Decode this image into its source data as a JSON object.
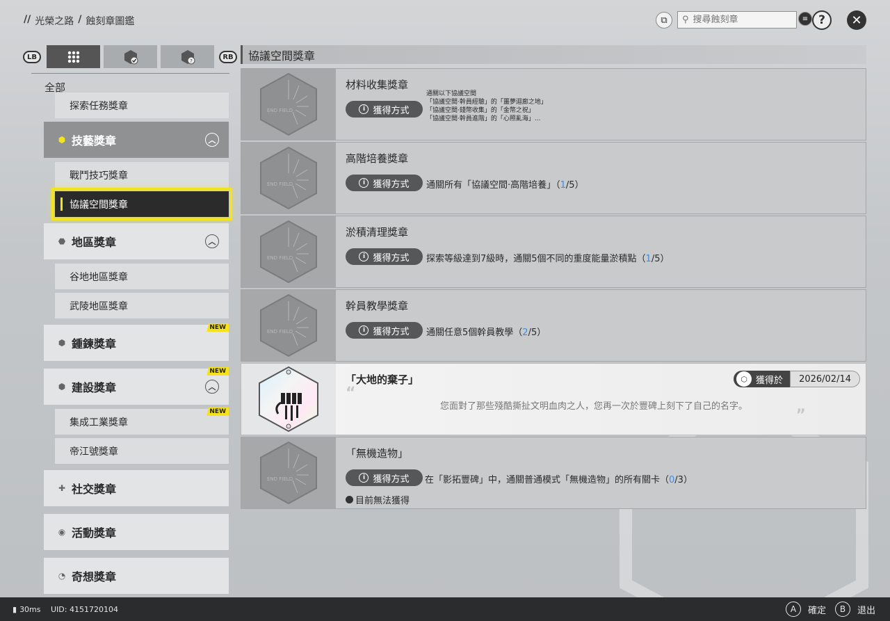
{
  "breadcrumb": [
    "光榮之路",
    "蝕刻章圖鑑"
  ],
  "search": {
    "placeholder": "搜尋蝕刻章"
  },
  "header_icons": {
    "filter": "filter-icon",
    "help": "?",
    "close": "✕",
    "list": "list-icon"
  },
  "tabs": {
    "lb": "LB",
    "rb": "RB"
  },
  "sidebar": {
    "all_label": "全部",
    "items": [
      {
        "type": "sub",
        "label": "探索任務獎章"
      },
      {
        "type": "cat",
        "label": "技藝獎章",
        "open": true
      },
      {
        "type": "sub",
        "label": "戰鬥技巧獎章"
      },
      {
        "type": "sub",
        "label": "協議空間獎章",
        "selected": true
      },
      {
        "type": "cat",
        "label": "地區獎章"
      },
      {
        "type": "sub",
        "label": "谷地地區獎章"
      },
      {
        "type": "sub",
        "label": "武陵地區獎章"
      },
      {
        "type": "cat",
        "label": "鍾鍊獎章",
        "badge": "NEW"
      },
      {
        "type": "cat",
        "label": "建設獎章",
        "badge": "NEW"
      },
      {
        "type": "sub",
        "label": "集成工業獎章",
        "badge": "NEW"
      },
      {
        "type": "sub",
        "label": "帝江號獎章"
      },
      {
        "type": "cat",
        "label": "社交獎章"
      },
      {
        "type": "cat",
        "label": "活動獎章"
      },
      {
        "type": "cat",
        "label": "奇想獎章"
      }
    ]
  },
  "section_title": "協議空間獎章",
  "method_label": "獲得方式",
  "cards": [
    {
      "name": "材料收集獎章",
      "cond_lines": [
        "通關以下協議空間",
        "「協議空間·幹員經驗」的「噩夢迴廊之地」",
        "「協議空間·錢幣收集」的「金幣之祝」",
        "「協議空間·幹員進階」的「心照亂海」..."
      ]
    },
    {
      "name": "高階培養獎章",
      "cond": "通關所有「協議空間·高階培養」（",
      "prog_cur": "1",
      "prog_total": "/5）"
    },
    {
      "name": "淤積清理獎章",
      "cond": "探索等級達到7級時，通關5個不同的重度能量淤積點（",
      "prog_cur": "1",
      "prog_total": "/5）"
    },
    {
      "name": "幹員教學獎章",
      "cond": "通關任意5個幹員教學（",
      "prog_cur": "2",
      "prog_total": "/5）"
    },
    {
      "name": "「大地的棄子」",
      "earned_label": "獲得於",
      "earned_date": "2026/02/14",
      "desc": "您面對了那些殘酷撕扯文明血肉之人，您再一次於豐碑上刻下了自己的名字。"
    },
    {
      "name": "「無機造物」",
      "cond": "在「影拓豐碑」中，通關普通模式「無機造物」的所有關卡（",
      "prog_cur": "0",
      "prog_total": "/3）",
      "unavailable": "目前無法獲得"
    }
  ],
  "thumb_text": "END FIELD",
  "footer": {
    "ping": "30ms",
    "uid": "UID: 4151720104",
    "confirm_key": "A",
    "confirm": "確定",
    "back_key": "B",
    "back": "退出"
  }
}
